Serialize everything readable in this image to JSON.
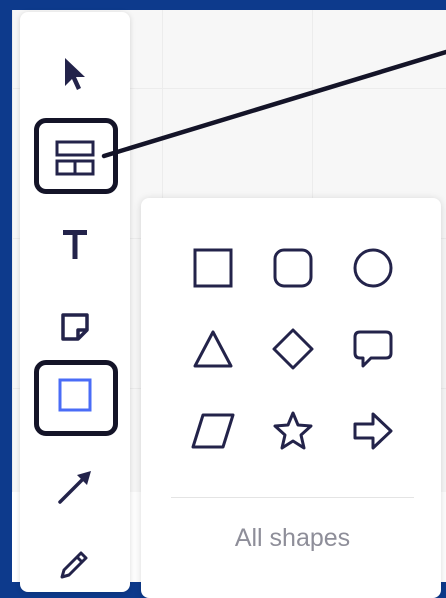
{
  "toolbar": {
    "tools": [
      {
        "name": "select-tool",
        "icon": "cursor-arrow-icon"
      },
      {
        "name": "templates-tool",
        "icon": "layout-template-icon",
        "highlighted": true
      },
      {
        "name": "text-tool",
        "icon": "text-T-icon"
      },
      {
        "name": "sticky-note-tool",
        "icon": "sticky-note-icon"
      },
      {
        "name": "shapes-tool",
        "icon": "square-icon",
        "highlighted": true,
        "active": true
      },
      {
        "name": "connector-tool",
        "icon": "arrow-line-icon"
      },
      {
        "name": "pen-tool",
        "icon": "pencil-icon"
      }
    ]
  },
  "shapes_panel": {
    "shapes": [
      "rectangle-icon",
      "rounded-rectangle-icon",
      "circle-icon",
      "triangle-icon",
      "diamond-icon",
      "speech-bubble-icon",
      "parallelogram-icon",
      "star-icon",
      "right-arrow-icon"
    ],
    "all_shapes_label": "All shapes"
  },
  "colors": {
    "frame_border": "#0d3a8c",
    "icon_stroke": "#23234a",
    "active_tool": "#4a6cf7",
    "highlight_border": "#141428",
    "label_gray": "#8e8e99"
  }
}
